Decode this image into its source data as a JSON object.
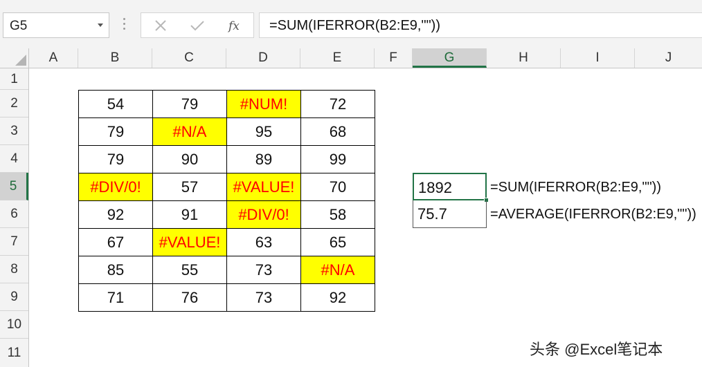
{
  "formula_bar": {
    "name_box": "G5",
    "formula": "=SUM(IFERROR(B2:E9,\"\"))"
  },
  "columns": [
    "A",
    "B",
    "C",
    "D",
    "E",
    "F",
    "G",
    "H",
    "I",
    "J"
  ],
  "rows": [
    "1",
    "2",
    "3",
    "4",
    "5",
    "6",
    "7",
    "8",
    "9",
    "10",
    "11"
  ],
  "table": [
    [
      "54",
      "79",
      "#NUM!",
      "72"
    ],
    [
      "79",
      "#N/A",
      "95",
      "68"
    ],
    [
      "79",
      "90",
      "89",
      "99"
    ],
    [
      "#DIV/0!",
      "57",
      "#VALUE!",
      "70"
    ],
    [
      "92",
      "91",
      "#DIV/0!",
      "58"
    ],
    [
      "67",
      "#VALUE!",
      "63",
      "65"
    ],
    [
      "85",
      "55",
      "73",
      "#N/A"
    ],
    [
      "71",
      "76",
      "73",
      "92"
    ]
  ],
  "results": {
    "g5": "1892",
    "g6": "75.7",
    "g5_formula": "=SUM(IFERROR(B2:E9,\"\"))",
    "g6_formula": "=AVERAGE(IFERROR(B2:E9,\"\"))"
  },
  "watermark": "头条 @Excel笔记本",
  "colors": {
    "error_fill": "#ffff00",
    "error_text": "#ff0000",
    "selection": "#217346"
  }
}
